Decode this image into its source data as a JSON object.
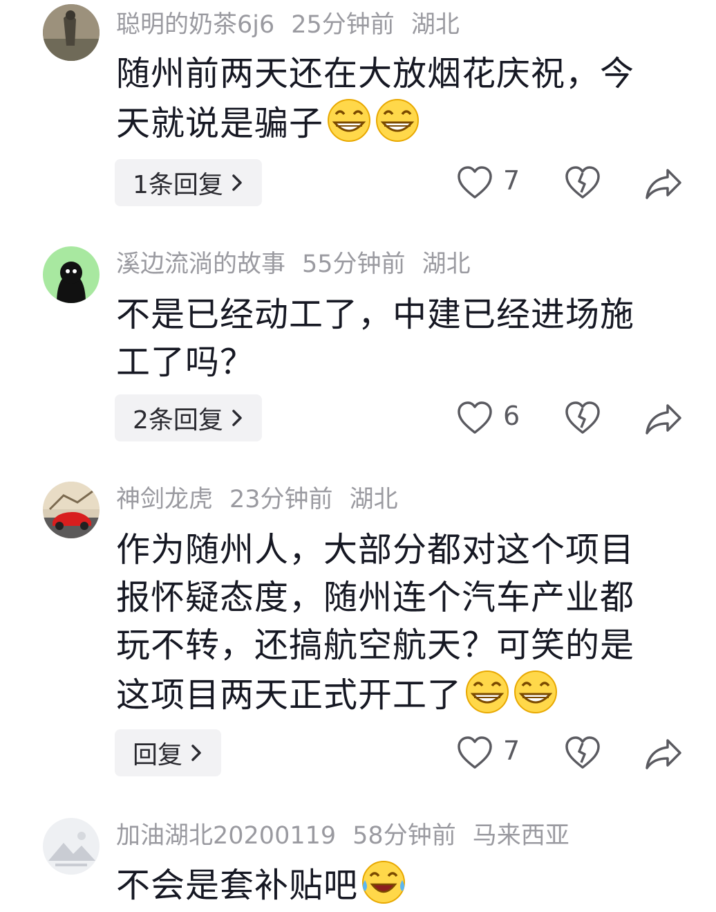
{
  "comments": [
    {
      "username": "聪明的奶茶6j6",
      "time": "25分钟前",
      "location": "湖北",
      "text": "随州前两天还在大放烟花庆祝，今天就说是骗子",
      "emojis": [
        "grin-emoji",
        "grin-emoji"
      ],
      "reply_label": "1条回复",
      "likes": "7"
    },
    {
      "username": "溪边流淌的故事",
      "time": "55分钟前",
      "location": "湖北",
      "text": "不是已经动工了，中建已经进场施工了吗？",
      "emojis": [],
      "reply_label": "2条回复",
      "likes": "6"
    },
    {
      "username": "神剑龙虎",
      "time": "23分钟前",
      "location": "湖北",
      "text": "作为随州人，大部分都对这个项目报怀疑态度，随州连个汽车产业都玩不转，还搞航空航天？可笑的是这项目两天正式开工了",
      "emojis": [
        "grin-emoji",
        "grin-emoji"
      ],
      "reply_label": "回复",
      "likes": "7"
    },
    {
      "username": "加油湖北20200119",
      "time": "58分钟前",
      "location": "马来西亚",
      "text": "不会是套补贴吧",
      "emojis": [
        "laugh-cry-emoji"
      ]
    }
  ],
  "icons": {
    "like": "heart-icon",
    "dislike": "broken-heart-icon",
    "share": "share-arrow-icon",
    "reply_chevron": "chevron-right-icon"
  },
  "colors": {
    "meta_text": "#9a9aa0",
    "body_text": "#161823",
    "reply_bg": "#f2f2f4",
    "icon_stroke": "#5a5a60"
  }
}
